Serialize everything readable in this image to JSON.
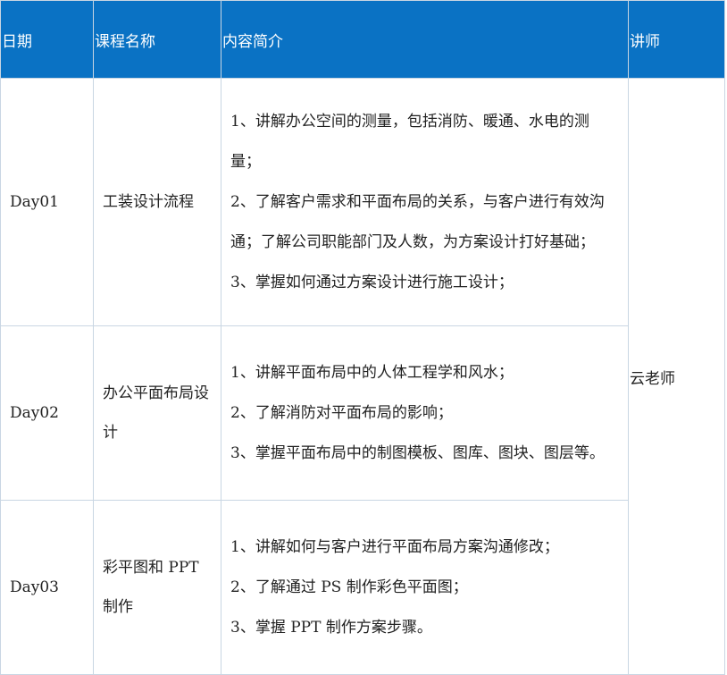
{
  "headers": {
    "date": "日期",
    "course": "课程名称",
    "content": "内容简介",
    "teacher": "讲师"
  },
  "rows": [
    {
      "date": "Day01",
      "course": "工装设计流程",
      "content": [
        "1、讲解办公空间的测量，包括消防、暖通、水电的测量；",
        "2、了解客户需求和平面布局的关系，与客户进行有效沟通；了解公司职能部门及人数，为方案设计打好基础；",
        "3、掌握如何通过方案设计进行施工设计；"
      ]
    },
    {
      "date": "Day02",
      "course": "办公平面布局设计",
      "content": [
        "1、讲解平面布局中的人体工程学和风水；",
        "2、了解消防对平面布局的影响；",
        "3、掌握平面布局中的制图模板、图库、图块、图层等。"
      ]
    },
    {
      "date": "Day03",
      "course": "彩平图和 PPT 制作",
      "content": [
        "1、讲解如何与客户进行平面布局方案沟通修改；",
        "2、了解通过 PS 制作彩色平面图；",
        "3、掌握 PPT 制作方案步骤。"
      ]
    }
  ],
  "teacher": "云老师",
  "colors": {
    "header_bg": "#0a72c4",
    "header_text": "#ffffff",
    "border": "#c9d6e3"
  }
}
